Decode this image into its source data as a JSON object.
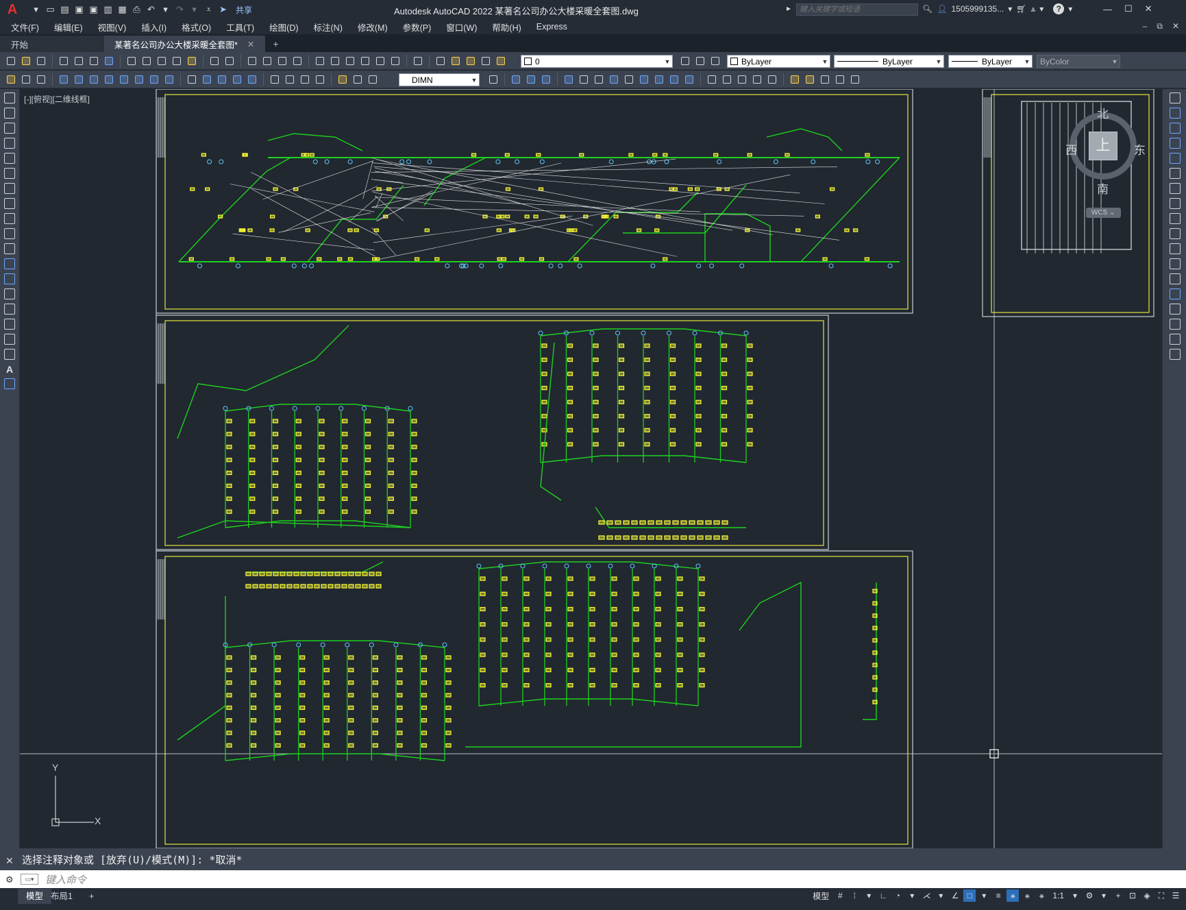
{
  "app": {
    "logo": "A",
    "window_title": "Autodesk AutoCAD 2022    某著名公司办公大楼采暖全套图.dwg",
    "share_label": "共享",
    "search_placeholder": "键入关键字或短语",
    "user": "1505999135...",
    "help": "?"
  },
  "menu": {
    "items": [
      "文件(F)",
      "编辑(E)",
      "视图(V)",
      "插入(I)",
      "格式(O)",
      "工具(T)",
      "绘图(D)",
      "标注(N)",
      "修改(M)",
      "参数(P)",
      "窗口(W)",
      "帮助(H)",
      "Express"
    ]
  },
  "tabs": {
    "items": [
      {
        "label": "开始",
        "active": false
      },
      {
        "label": "某著名公司办公大楼采暖全套图*",
        "active": true
      }
    ],
    "close": "✕",
    "add": "+"
  },
  "properties": {
    "layer": "0",
    "color": "ByLayer",
    "linetype": "ByLayer",
    "lineweight": "ByLayer",
    "plotstyle": "ByColor",
    "dimstyle": "DIMN"
  },
  "viewport": {
    "label": "[-][俯视][二维线框]"
  },
  "viewcube": {
    "north": "北",
    "south": "南",
    "west": "西",
    "east": "东",
    "top": "上",
    "wcs": "WCS ⌄"
  },
  "ucs": {
    "x": "X",
    "y": "Y"
  },
  "command": {
    "history": "选择注释对象或 [放弃(U)/模式(M)]: *取消*",
    "placeholder": "键入命令",
    "close": "✕"
  },
  "status": {
    "layouts": [
      {
        "label": "模型",
        "active": true
      },
      {
        "label": "布局1",
        "active": false
      }
    ],
    "add": "+",
    "model_label": "模型",
    "scale": "1:1"
  },
  "colors": {
    "pipe": "#1ed21e",
    "device": "#ffff33",
    "frame": "#e6e63c",
    "canvas": "#212830"
  }
}
